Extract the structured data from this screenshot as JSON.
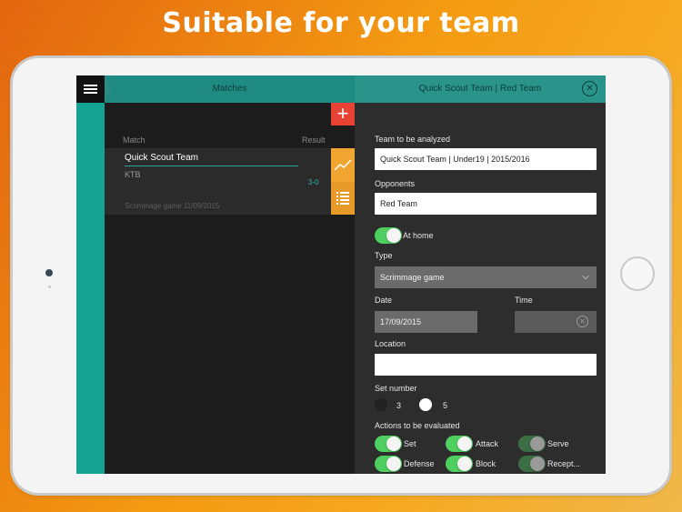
{
  "headline": "Suitable for your team",
  "topbar": {
    "matches_label": "Matches",
    "team_title": "Quick Scout Team | Red Team",
    "close_icon": "close-icon"
  },
  "left": {
    "col_match": "Match",
    "col_result": "Result",
    "add_icon": "plus-icon",
    "card": {
      "team": "Quick Scout Team",
      "opponent": "KTB",
      "score": "3-0",
      "subtitle": "Scrimmage game 11/09/2015"
    }
  },
  "form": {
    "team_label": "Team to be analyzed",
    "team_value": "Quick Scout Team | Under19 | 2015/2016",
    "opponents_label": "Opponents",
    "opponents_value": "Red Team",
    "at_home_label": "At home",
    "at_home_on": true,
    "type_label": "Type",
    "type_value": "Scrimmage game",
    "date_label": "Date",
    "date_value": "17/09/2015",
    "time_label": "Time",
    "time_value": "",
    "location_label": "Location",
    "location_value": "",
    "set_number_label": "Set number",
    "set_options": [
      "3",
      "5"
    ],
    "set_selected": "5",
    "actions_label": "Actions to be evaluated",
    "actions": [
      {
        "label": "Set",
        "on": true
      },
      {
        "label": "Attack",
        "on": true
      },
      {
        "label": "Serve",
        "on": false
      },
      {
        "label": "Defense",
        "on": true
      },
      {
        "label": "Block",
        "on": true
      },
      {
        "label": "Recept...",
        "on": false
      }
    ]
  },
  "colors": {
    "accent_teal": "#14a393",
    "toggle_on": "#4fcf5f",
    "add_red": "#e84235",
    "side_orange": "#f0a531"
  }
}
